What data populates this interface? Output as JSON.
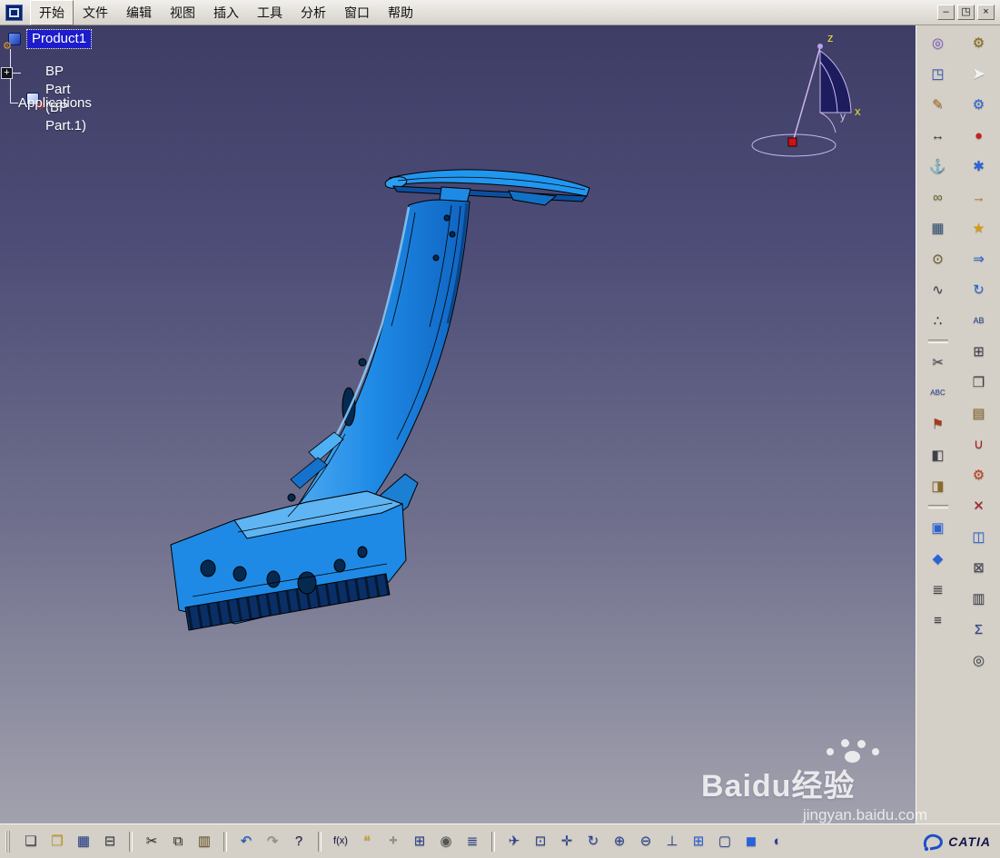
{
  "window": {
    "controls": [
      {
        "name": "minimize-button",
        "glyph": "–"
      },
      {
        "name": "restore-button",
        "glyph": "◳"
      },
      {
        "name": "close-button",
        "glyph": "×"
      }
    ]
  },
  "menubar": {
    "active": "开始",
    "items": [
      {
        "label": "开始"
      },
      {
        "label": "文件"
      },
      {
        "label": "编辑"
      },
      {
        "label": "视图"
      },
      {
        "label": "插入"
      },
      {
        "label": "工具"
      },
      {
        "label": "分析"
      },
      {
        "label": "窗口"
      },
      {
        "label": "帮助"
      }
    ]
  },
  "tree": {
    "expander": "+",
    "root": {
      "label": "Product1",
      "selected": true
    },
    "children": [
      {
        "label": "BP Part (BP Part.1)"
      },
      {
        "label": "Applications"
      }
    ]
  },
  "compass": {
    "z": "z",
    "x": "x",
    "y": "y"
  },
  "model": {
    "part": "BP Part (car B-pillar)",
    "color": "#1e8ae6"
  },
  "watermark": {
    "brand": "Baidu",
    "brand_cn": "经验",
    "url": "jingyan.baidu.com"
  },
  "brand": {
    "name": "CATIA"
  },
  "right_toolbar": {
    "col1": [
      {
        "name": "camera-view-tool",
        "glyph": "◎",
        "color": "#7a55cc"
      },
      {
        "name": "workbench-cube-tool",
        "glyph": "◳",
        "color": "#3355bb"
      },
      {
        "name": "sketch-pen-tool",
        "glyph": "✎",
        "color": "#b06a20"
      },
      {
        "name": "measure-tool",
        "glyph": "↔",
        "color": "#40404a"
      },
      {
        "name": "anchor-constraint-tool",
        "glyph": "⚓",
        "color": "#40404a"
      },
      {
        "name": "attach-clip-tool",
        "glyph": "∞",
        "color": "#6b6b30"
      },
      {
        "name": "image-capture-tool",
        "glyph": "▦",
        "color": "#355577"
      },
      {
        "name": "link-manager-tool",
        "glyph": "⊙",
        "color": "#6b5524"
      },
      {
        "name": "spline-curve-tool",
        "glyph": "∿",
        "color": "#40404a"
      },
      {
        "name": "point-cloud-tool",
        "glyph": "∴",
        "color": "#40404a"
      },
      {
        "sep": true
      },
      {
        "name": "section-cut-tool",
        "glyph": "✂",
        "color": "#40404a"
      },
      {
        "name": "spell-check-tool",
        "glyph": "ABC",
        "color": "#28418f",
        "size": 8
      },
      {
        "name": "flag-note-tool",
        "glyph": "⚑",
        "color": "#a33c1e"
      },
      {
        "name": "depth-effect-tool",
        "glyph": "◧",
        "color": "#40404a"
      },
      {
        "name": "apply-material-tool",
        "glyph": "◨",
        "color": "#8a6a2a"
      },
      {
        "sep": true
      },
      {
        "name": "part-body-tool",
        "glyph": "▣",
        "color": "#2a62d8"
      },
      {
        "name": "prism-feature-tool",
        "glyph": "◆",
        "color": "#2a62d8"
      },
      {
        "name": "product-structure-tool",
        "glyph": "≣",
        "color": "#40404a"
      },
      {
        "name": "graph-tree-tool",
        "glyph": "≡",
        "color": "#40404a"
      }
    ],
    "col2": [
      {
        "name": "powercopy-tool",
        "glyph": "⚙",
        "color": "#8a6a10"
      },
      {
        "name": "select-arrow-tool",
        "glyph": "➤",
        "color": "#f2f2f2",
        "size": 18
      },
      {
        "name": "settings-gear-tool",
        "glyph": "⚙",
        "color": "#2a62d8"
      },
      {
        "name": "red-sphere-tool",
        "glyph": "●",
        "color": "#c42222"
      },
      {
        "name": "sphere-gear-tool",
        "glyph": "✱",
        "color": "#2a62d8"
      },
      {
        "name": "exit-workbench-tool",
        "glyph": "→",
        "color": "#b08a10"
      },
      {
        "name": "catalog-star-tool",
        "glyph": "★",
        "color": "#d89a10"
      },
      {
        "name": "jump-arrow-tool",
        "glyph": "⇒",
        "color": "#2a62d8"
      },
      {
        "name": "update-tool",
        "glyph": "↻",
        "color": "#2a62d8"
      },
      {
        "name": "text-annotation-tool",
        "glyph": "AB",
        "color": "#28418f",
        "size": 9
      },
      {
        "name": "product-tree-tool",
        "glyph": "⊞",
        "color": "#40404a"
      },
      {
        "name": "new-window-tool",
        "glyph": "❒",
        "color": "#40404a"
      },
      {
        "name": "layers-tool",
        "glyph": "▤",
        "color": "#8a6a2a"
      },
      {
        "name": "snap-tool",
        "glyph": "∪",
        "color": "#a32222"
      },
      {
        "name": "red-gear-tool",
        "glyph": "⚙",
        "color": "#c03a1e"
      },
      {
        "name": "delete-cross-tool",
        "glyph": "✕",
        "color": "#a32222"
      },
      {
        "name": "component-box-tool",
        "glyph": "◫",
        "color": "#2a62d8"
      },
      {
        "name": "grid-snap-tool",
        "glyph": "⊠",
        "color": "#40404a"
      },
      {
        "name": "list-panel-tool",
        "glyph": "▥",
        "color": "#40404a"
      },
      {
        "name": "analysis-sigma-tool",
        "glyph": "Σ",
        "color": "#28418f"
      },
      {
        "name": "target-frame-tool",
        "glyph": "◎",
        "color": "#40404a"
      }
    ]
  },
  "bottom_toolbar": {
    "items": [
      {
        "name": "new-document-button",
        "glyph": "❏",
        "color": "#3a3a44"
      },
      {
        "name": "open-folder-button",
        "glyph": "❒",
        "color": "#c59a1a"
      },
      {
        "name": "save-button",
        "glyph": "▦",
        "color": "#28418f"
      },
      {
        "name": "print-button",
        "glyph": "⊟",
        "color": "#3a3a44"
      },
      {
        "sep": true
      },
      {
        "name": "cut-button",
        "glyph": "✂",
        "color": "#333333"
      },
      {
        "name": "copy-button",
        "glyph": "⧉",
        "color": "#333333"
      },
      {
        "name": "paste-button",
        "glyph": "▥",
        "color": "#6b5524"
      },
      {
        "sep": true
      },
      {
        "name": "undo-button",
        "glyph": "↶",
        "color": "#1a53c0"
      },
      {
        "name": "redo-button",
        "glyph": "↷",
        "color": "#8f8d85"
      },
      {
        "name": "whats-this-help-button",
        "glyph": "?",
        "color": "#202048"
      },
      {
        "sep": true
      },
      {
        "name": "formula-button",
        "glyph": "f(x)",
        "color": "#202048",
        "size": 11
      },
      {
        "name": "comment-bubble-button",
        "glyph": "❝",
        "color": "#caa43a"
      },
      {
        "name": "measure-between-button",
        "glyph": "✛",
        "color": "#777777",
        "size": 11
      },
      {
        "name": "design-table-button",
        "glyph": "⊞",
        "color": "#28418f"
      },
      {
        "name": "lock-button",
        "glyph": "◉",
        "color": "#555555"
      },
      {
        "name": "rules-list-button",
        "glyph": "≣",
        "color": "#28418f"
      },
      {
        "sep": true
      },
      {
        "name": "fly-mode-button",
        "glyph": "✈",
        "color": "#28418f"
      },
      {
        "name": "fit-all-in-button",
        "glyph": "⊡",
        "color": "#28418f"
      },
      {
        "name": "pan-button",
        "glyph": "✛",
        "color": "#28418f"
      },
      {
        "name": "rotate-button",
        "glyph": "↻",
        "color": "#28418f"
      },
      {
        "name": "zoom-in-button",
        "glyph": "⊕",
        "color": "#28418f"
      },
      {
        "name": "zoom-out-button",
        "glyph": "⊖",
        "color": "#28418f"
      },
      {
        "name": "normal-view-button",
        "glyph": "⊥",
        "color": "#28418f"
      },
      {
        "name": "multi-view-button",
        "glyph": "⊞",
        "color": "#2a62d8"
      },
      {
        "name": "wireframe-view-button",
        "glyph": "▢",
        "color": "#28418f"
      },
      {
        "name": "shaded-view-button",
        "glyph": "◼",
        "color": "#2a62d8"
      },
      {
        "name": "hide-show-button",
        "glyph": "◐",
        "color": "#28418f"
      }
    ]
  }
}
